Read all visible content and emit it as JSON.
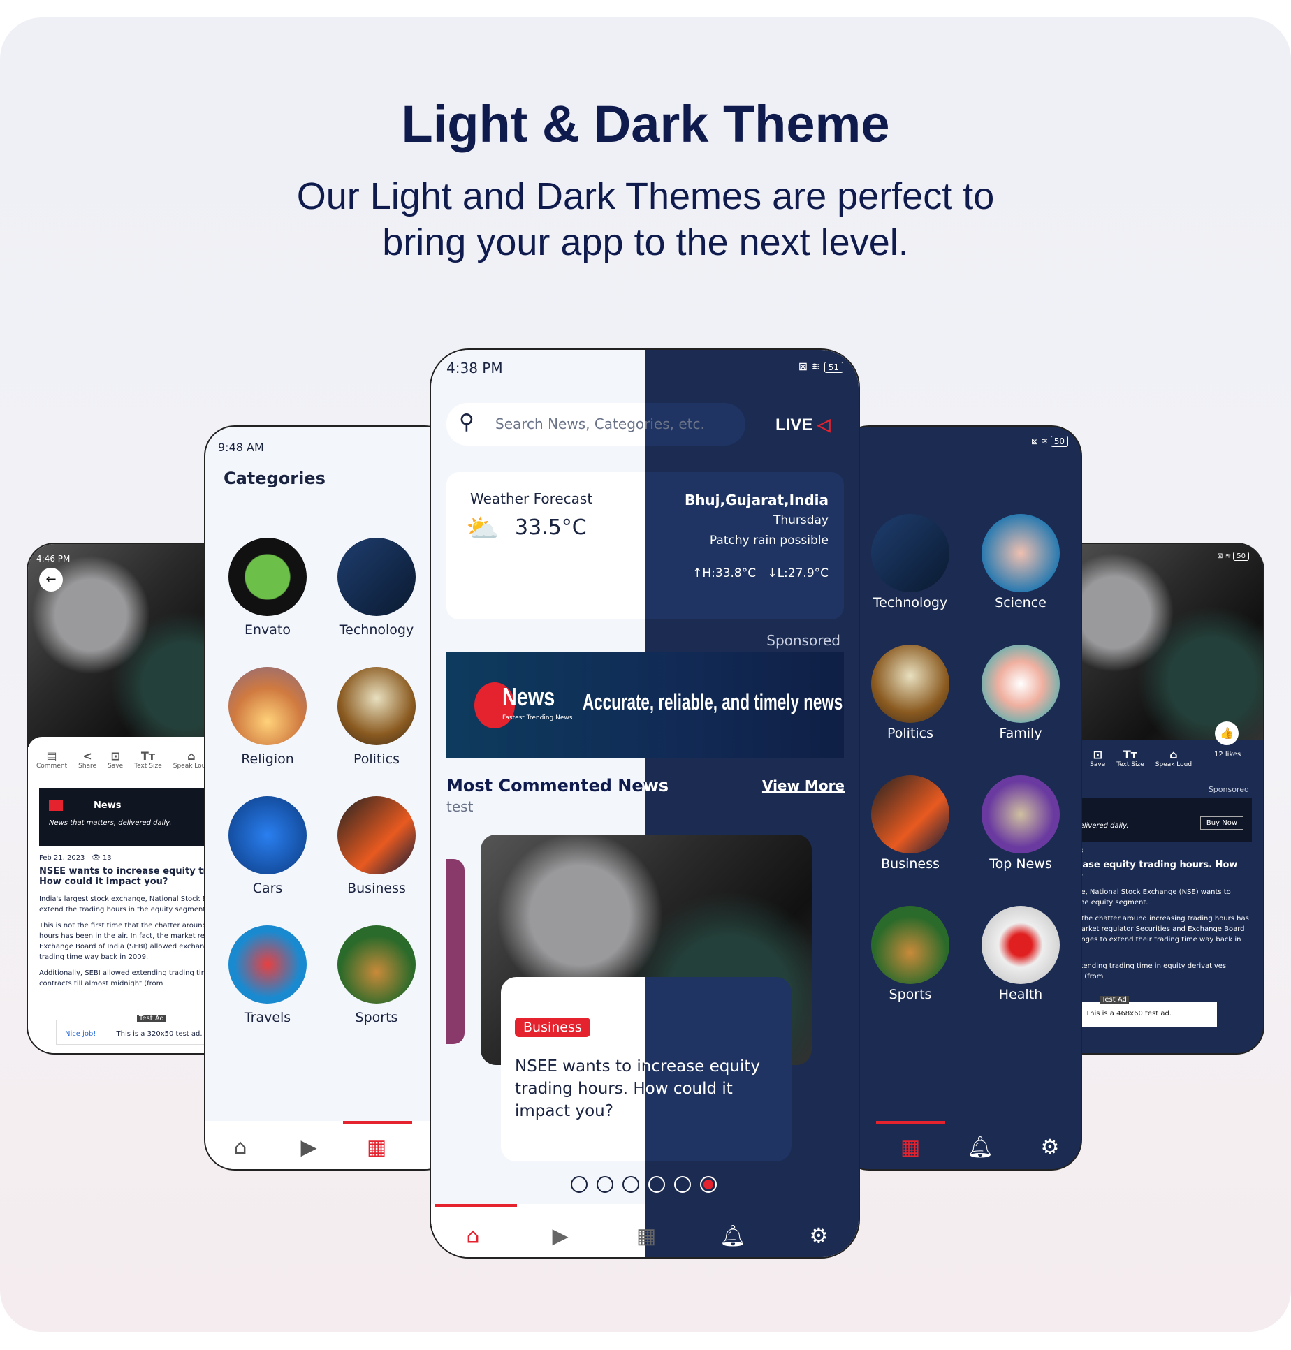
{
  "header": {
    "title": "Light & Dark Theme",
    "subtitle_line1": "Our Light and Dark Themes are perfect to",
    "subtitle_line2": "bring your app to the next level."
  },
  "colors": {
    "navy": "#1b2b52",
    "card_dark": "#1f3462",
    "accent_red": "#e5232f",
    "title": "#0f1a4d"
  },
  "article_light": {
    "time": "4:46 PM",
    "actions": [
      "Comment",
      "Share",
      "Save",
      "Text Size",
      "Speak Loud"
    ],
    "ad_brand": "News",
    "ad_tagline": "News that matters, delivered daily.",
    "date": "Feb 21, 2023",
    "views": "13",
    "headline": "NSEE wants to increase equity trading hours. How could it impact you?",
    "para1": "India's largest stock exchange, National Stock Exchange (NSE) wants to extend the trading hours in the equity segment.",
    "para2": "This is not the first time that the chatter around increasing trading hours has been in the air. In fact, the market regulator Securities and Exchange Board of India (SEBI) allowed exchanges to extend their trading time way back in 2009.",
    "para3": "Additionally, SEBI allowed extending trading time in equity derivatives contracts till almost midnight (from",
    "test_ad_label": "Test Ad",
    "ad_left": "Nice job!",
    "ad_text": "This is a 320x50 test ad."
  },
  "article_dark": {
    "likes": "12 likes",
    "sponsored": "Sponsored",
    "buy_now": "Buy Now",
    "ad_text": "This is a 468x60 test ad.",
    "battery": "50"
  },
  "categories_light": {
    "time": "9:48 AM",
    "title": "Categories",
    "items": [
      "Envato",
      "Technology",
      "Religion",
      "Politics",
      "Cars",
      "Business",
      "Travels",
      "Sports"
    ]
  },
  "categories_dark": {
    "battery": "50",
    "items": [
      "Technology",
      "Science",
      "Politics",
      "Family",
      "Business",
      "Top News",
      "Sports",
      "Health"
    ]
  },
  "home": {
    "time": "4:38 PM",
    "battery": "51",
    "search_placeholder": "Search News, Categories, etc.",
    "live": "LIVE",
    "weather": {
      "title": "Weather Forecast",
      "temp": "33.5°C",
      "location": "Bhuj,Gujarat,India",
      "day": "Thursday",
      "condition": "Patchy rain possible",
      "high": "H:33.8°C",
      "low": "L:27.9°C"
    },
    "sponsored": "Sponsored",
    "banner_brand": "News",
    "banner_brand_sub": "Fastest Trending News",
    "banner_tagline": "Accurate, reliable, and timely news",
    "section_title": "Most Commented News",
    "section_sub": "test",
    "view_more": "View More",
    "card": {
      "badge": "Business",
      "headline": "NSEE wants to increase equity trading hours. How could it impact you?"
    },
    "carousel_active_index": 5,
    "carousel_count": 6,
    "nav": [
      "home-icon",
      "video-icon",
      "categories-icon",
      "bell-icon",
      "gear-icon"
    ]
  }
}
